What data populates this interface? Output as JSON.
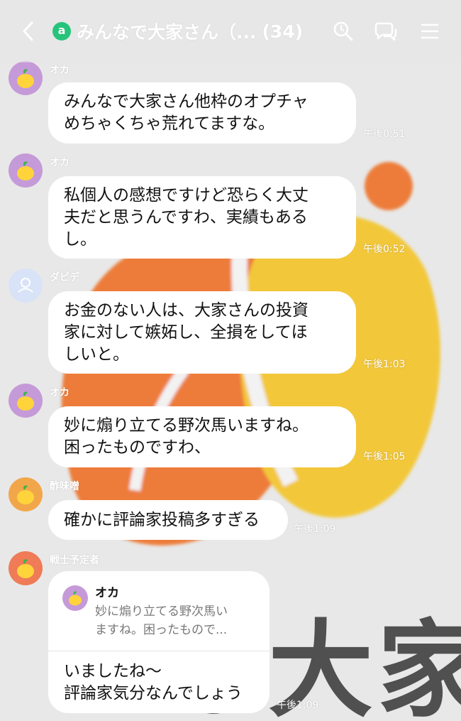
{
  "header": {
    "badge": "a",
    "title": "みんなで大家さん（...",
    "member_count": "(34)",
    "icons": [
      "back-chevron-icon",
      "search-icon",
      "chat-bubbles-icon",
      "menu-icon"
    ]
  },
  "colors": {
    "official_badge": "#26c47a",
    "avatar_purple": "#c59ad8",
    "avatar_orange": "#f2a64a",
    "avatar_red": "#ef7b57",
    "avatar_default": "#d9e3f7",
    "lemon": "#ffd43b",
    "background_orange": "#ee6a1f",
    "background_yellow": "#f4c21a"
  },
  "messages": [
    {
      "sender": "オカ",
      "lines": [
        "みんなで大家さん他枠のオプチャ",
        "めちゃくちゃ荒れてますな。"
      ],
      "time": "午後0:51"
    },
    {
      "sender": "オカ",
      "lines": [
        "私個人の感想ですけど恐らく大丈",
        "夫だと思うんですわ、実績もある",
        "し。"
      ],
      "time": "午後0:52"
    },
    {
      "sender": "ダビデ",
      "lines": [
        "お金のない人は、大家さんの投資",
        "家に対して嫉妬し、全損をしてほ",
        "しいと。"
      ],
      "time": "午後1:03"
    },
    {
      "sender": "オカ",
      "lines": [
        "妙に煽り立てる野次馬いますね。",
        "困ったものですわ、"
      ],
      "time": "午後1:05"
    },
    {
      "sender": "酢味噌",
      "lines": [
        "確かに評論家投稿多すぎる"
      ],
      "time": "午後1:09"
    },
    {
      "sender": "戦士予定者",
      "quote": {
        "name": "オカ",
        "lines": [
          "妙に煽り立てる野次馬い",
          "ますね。困ったもので..."
        ]
      },
      "lines": [
        "いましたね〜",
        "評論家気分なんでしょう"
      ],
      "time": "午後1:09"
    }
  ],
  "background": {
    "watermark_text": "んな大家"
  }
}
